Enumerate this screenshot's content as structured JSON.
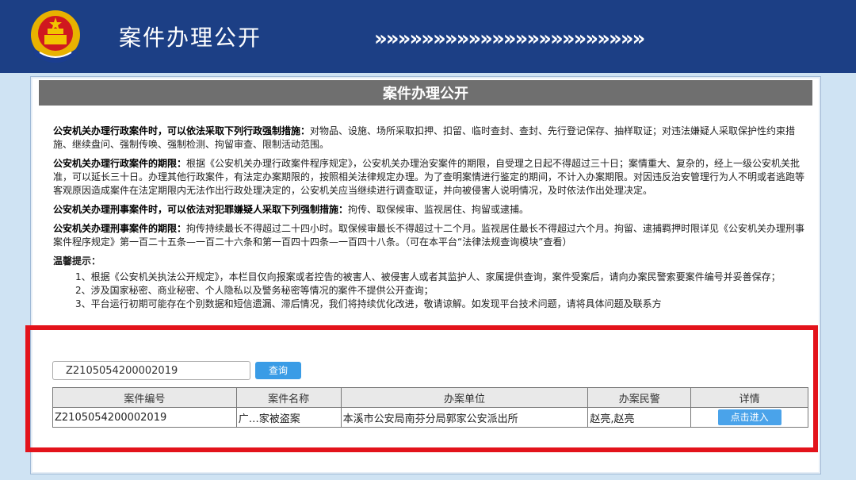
{
  "app": {
    "title": "案件办理公开",
    "chevrons": "»»»»»»»»»»»»»»»»»»»»»»»"
  },
  "page": {
    "heading": "案件办理公开",
    "paragraphs": [
      {
        "lead": "公安机关办理行政案件时，可以依法采取下列行政强制措施：",
        "body": "对物品、设施、场所采取扣押、扣留、临时查封、查封、先行登记保存、抽样取证；对违法嫌疑人采取保护性约束措施、继续盘问、强制传唤、强制检测、拘留审查、限制活动范围。"
      },
      {
        "lead": "公安机关办理行政案件的期限：",
        "body": "根据《公安机关办理行政案件程序规定》，公安机关办理治安案件的期限，自受理之日起不得超过三十日；案情重大、复杂的，经上一级公安机关批准，可以延长三十日。办理其他行政案件，有法定办案期限的，按照相关法律规定办理。为了查明案情进行鉴定的期间，不计入办案期限。对因违反治安管理行为人不明或者逃跑等客观原因造成案件在法定期限内无法作出行政处理决定的，公安机关应当继续进行调查取证，并向被侵害人说明情况，及时依法作出处理决定。"
      },
      {
        "lead": "公安机关办理刑事案件时，可以依法对犯罪嫌疑人采取下列强制措施：",
        "body": "拘传、取保候审、监视居住、拘留或逮捕。"
      },
      {
        "lead": "公安机关办理刑事案件的期限：",
        "body": "拘传持续最长不得超过二十四小时。取保候审最长不得超过十二个月。监视居住最长不得超过六个月。拘留、逮捕羁押时限详见《公安机关办理刑事案件程序规定》第一百二十五条—一百二十六条和第一百四十四条—一百四十八条。（可在本平台“法律法规查询模块”查看）"
      }
    ],
    "tips_title": "温馨提示：",
    "tips": [
      "1、根据《公安机关执法公开规定》，本栏目仅向报案或者控告的被害人、被侵害人或者其监护人、家属提供查询，案件受案后，请向办案民警索要案件编号并妥善保存；",
      "2、涉及国家秘密、商业秘密、个人隐私以及警务秘密等情况的案件不提供公开查询；",
      "3、平台运行初期可能存在个别数据和短信遗漏、滞后情况，我们将持续优化改进，敬请谅解。如发现平台技术问题，请将具体问题及联系方"
    ]
  },
  "search": {
    "value": "Z2105054200002019",
    "button_label": "查询"
  },
  "table": {
    "headers": [
      "案件编号",
      "案件名称",
      "办案单位",
      "办案民警",
      "详情"
    ],
    "rows": [
      {
        "case_no": "Z2105054200002019",
        "case_name": "广…家被盗案",
        "unit": "本溪市公安局南芬分局郭家公安派出所",
        "officers": "赵亮,赵亮",
        "action": "点击进入"
      }
    ]
  }
}
